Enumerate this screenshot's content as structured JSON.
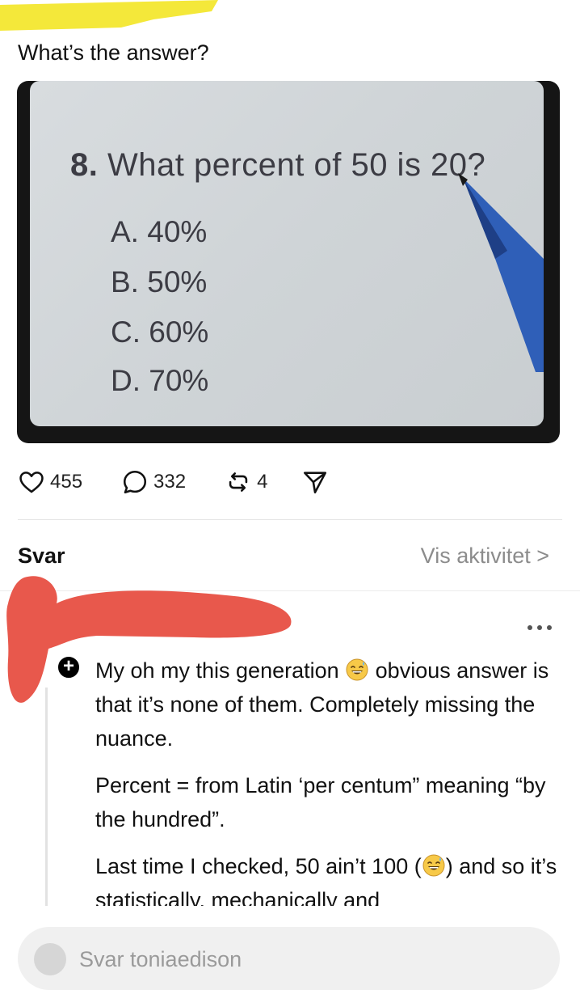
{
  "post": {
    "text": "What’s the answer?",
    "image": {
      "question_number": "8.",
      "question_text": " What percent of 50 is 20?",
      "options": [
        "A. 40%",
        "B. 50%",
        "C. 60%",
        "D. 70%"
      ]
    },
    "actions": {
      "likes": "455",
      "comments": "332",
      "reposts": "4"
    }
  },
  "replies_section": {
    "title": "Svar",
    "activity_link": "Vis aktivitet >"
  },
  "reply": {
    "p1_a": "My oh my this generation ",
    "p1_b": " obvious answer is that it’s none of them. Completely missing the nuance.",
    "p2": "Percent = from Latin ‘per centum” meaning “by the hundred”.",
    "p3_a": "Last time I checked, 50 ain’t 100 (",
    "p3_b": ") and so it’s statistically, mechanically and",
    "emoji": "grinning-sweat-emoji"
  },
  "composer": {
    "placeholder": "Svar toniaedison"
  },
  "colors": {
    "scribble_yellow": "#f4e83a",
    "scribble_red": "#e8584c",
    "pen_blue": "#2f5fb8"
  }
}
